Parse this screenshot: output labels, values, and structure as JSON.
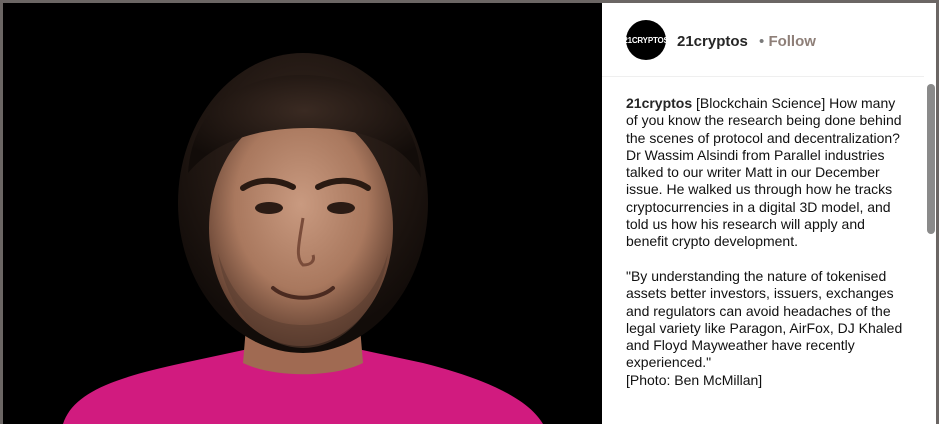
{
  "post": {
    "photo_alt": "Portrait of Dr Wassim Alsindi",
    "colors": {
      "shirt": "#d11b7f",
      "background": "#000000",
      "accent": "#8e7f78"
    }
  },
  "header": {
    "avatar_text": "21CRYPTOS",
    "username": "21cryptos",
    "separator": "•",
    "follow_label": "Follow"
  },
  "caption": {
    "username": "21cryptos",
    "text": " [Blockchain Science] How many of you know the research being done behind the scenes of protocol and decentralization? Dr Wassim Alsindi from Parallel industries talked to our writer Matt in our December issue. He walked us through how he tracks cryptocurrencies in a digital 3D model, and told us how his research will apply and benefit crypto development.\n\n\"By understanding the nature of tokenised assets better investors, issuers, exchanges and regulators can avoid headaches of the legal variety like Paragon, AirFox, DJ Khaled and Floyd Mayweather have recently experienced.\"\n[Photo: Ben McMillan]"
  }
}
